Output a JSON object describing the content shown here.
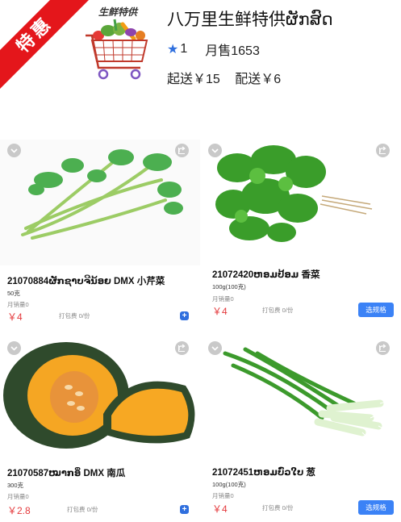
{
  "shop": {
    "badge": "特惠",
    "logo_text": "生鲜特供",
    "name": "八万里生鲜特供ຜັກສົດ",
    "rating": "1",
    "monthly_sales": "月售1653",
    "min_order": "起送￥15",
    "delivery_fee": "配送￥6"
  },
  "products": [
    {
      "title": "21070884ຜັກຊາບຈີນ້ອຍ DMX 小芹菜",
      "spec": "50克",
      "sold": "月销量0",
      "price": "￥4",
      "pack_fee": "打包费 0/份",
      "action": "+",
      "icon": "celery-image"
    },
    {
      "title": "21072420ຫອມປ້ອມ 香菜",
      "spec": "100g(100克)",
      "sold": "月销量0",
      "price": "￥4",
      "pack_fee": "打包费 0/份",
      "action": "选规格",
      "icon": "coriander-image"
    },
    {
      "title": "21070587ໝາກອຶ DMX 南瓜",
      "spec": "300克",
      "sold": "月销量0",
      "price": "￥2.8",
      "pack_fee": "打包费 0/份",
      "action": "+",
      "icon": "pumpkin-image"
    },
    {
      "title": "21072451ຫອມບົ່ວໃບ 葱",
      "spec": "100g(100克)",
      "sold": "月销量0",
      "price": "￥4",
      "pack_fee": "打包费 0/份",
      "action": "选规格",
      "icon": "scallion-image"
    }
  ],
  "colors": {
    "accent": "#2f6fde",
    "price": "#e4393c",
    "ribbon": "#e4161b"
  }
}
